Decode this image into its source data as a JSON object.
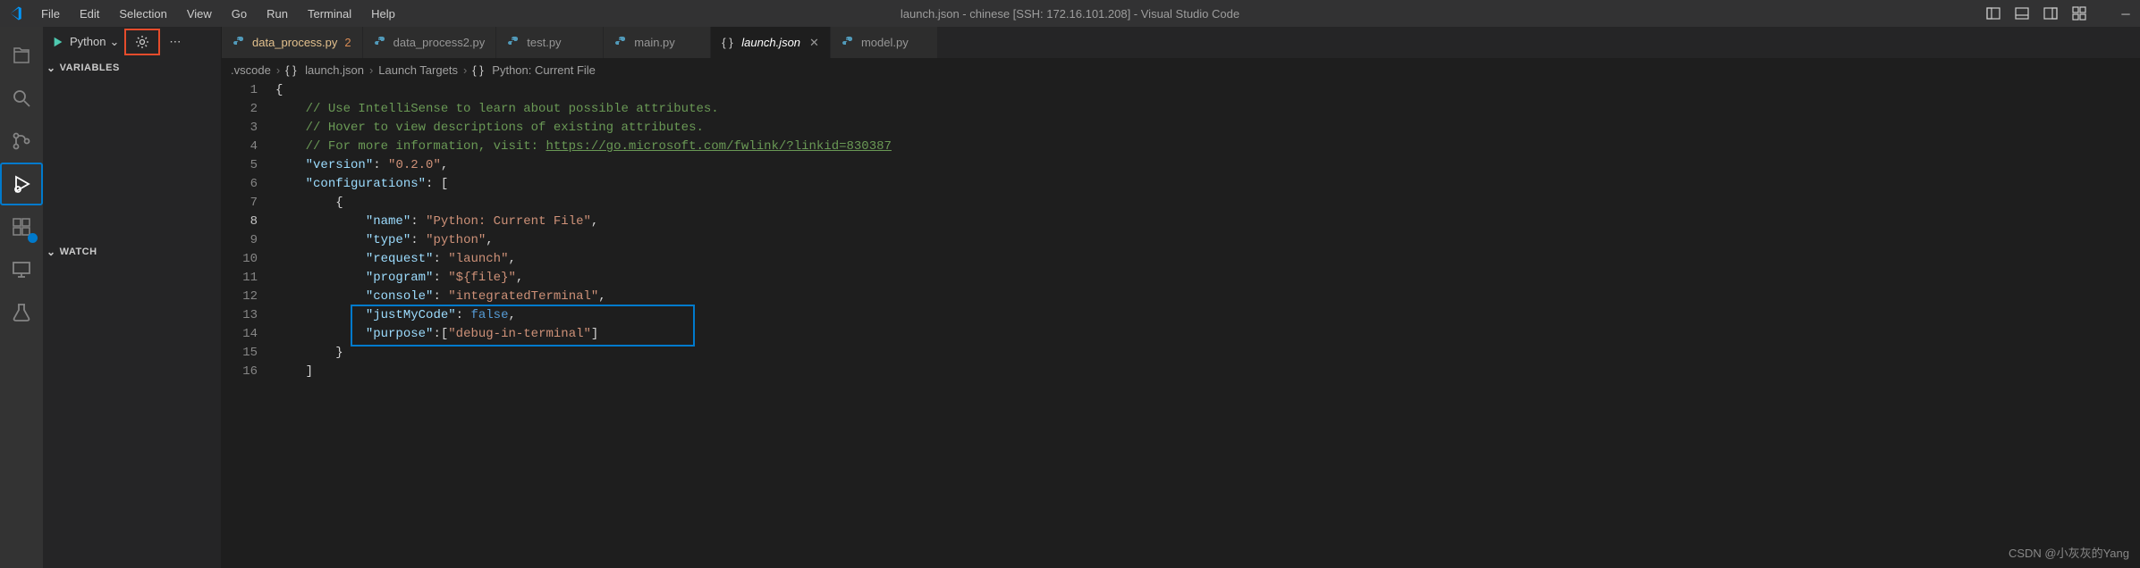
{
  "menubar": [
    "File",
    "Edit",
    "Selection",
    "View",
    "Go",
    "Run",
    "Terminal",
    "Help"
  ],
  "window_title": "launch.json - chinese [SSH: 172.16.101.208] - Visual Studio Code",
  "debug": {
    "config_name": "Python"
  },
  "sections": {
    "variables": "VARIABLES",
    "watch": "WATCH"
  },
  "tabs": [
    {
      "name": "data_process.py",
      "icon": "py",
      "modified": true,
      "mod_count": "2",
      "active": false
    },
    {
      "name": "data_process2.py",
      "icon": "py",
      "modified": false,
      "active": false
    },
    {
      "name": "test.py",
      "icon": "py",
      "modified": false,
      "active": false
    },
    {
      "name": "main.py",
      "icon": "py",
      "modified": false,
      "active": false
    },
    {
      "name": "launch.json",
      "icon": "json",
      "modified": false,
      "active": true
    },
    {
      "name": "model.py",
      "icon": "py",
      "modified": false,
      "active": false
    }
  ],
  "breadcrumbs": {
    "parts": [
      ".vscode",
      "launch.json",
      "Launch Targets",
      "Python: Current File"
    ]
  },
  "code": {
    "lines": [
      "1",
      "2",
      "3",
      "4",
      "5",
      "6",
      "7",
      "8",
      "9",
      "10",
      "11",
      "12",
      "13",
      "14",
      "15",
      "16"
    ],
    "current_line_index": 7,
    "content": {
      "version_key": "\"version\"",
      "version_val": "\"0.2.0\"",
      "configurations_key": "\"configurations\"",
      "name_key": "\"name\"",
      "name_val": "\"Python: Current File\"",
      "type_key": "\"type\"",
      "type_val": "\"python\"",
      "request_key": "\"request\"",
      "request_val": "\"launch\"",
      "program_key": "\"program\"",
      "program_val": "\"${file}\"",
      "console_key": "\"console\"",
      "console_val": "\"integratedTerminal\"",
      "justmycode_key": "\"justMyCode\"",
      "justmycode_val": "false",
      "purpose_key": "\"purpose\"",
      "purpose_val": "\"debug-in-terminal\"",
      "comment1": "// Use IntelliSense to learn about possible attributes.",
      "comment2": "// Hover to view descriptions of existing attributes.",
      "comment3a": "// For more information, visit: ",
      "comment3_url": "https://go.microsoft.com/fwlink/?linkid=830387"
    }
  },
  "watermark": "CSDN @小灰灰的Yang"
}
